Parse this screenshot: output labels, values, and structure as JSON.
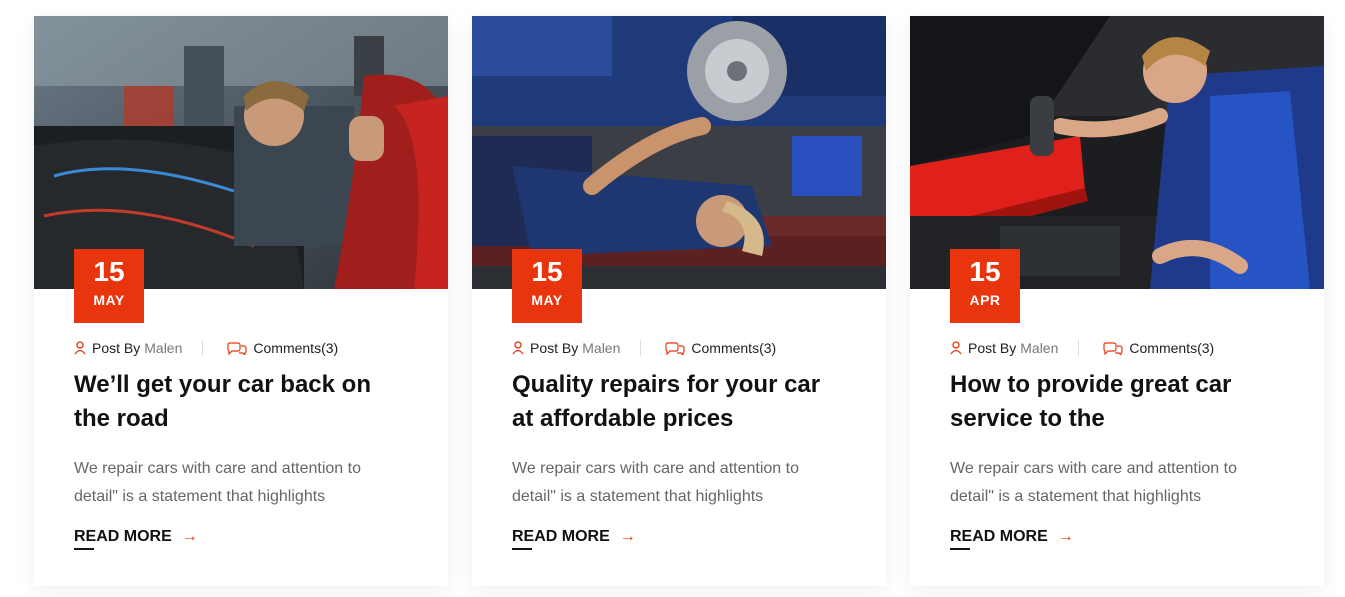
{
  "colors": {
    "accent": "#e8350d",
    "text": "#111111",
    "muted": "#666666"
  },
  "posts": [
    {
      "image": "mechanic inspecting car engine bay",
      "day": "15",
      "month": "MAY",
      "post_by_label": "Post By",
      "author": "Malen",
      "comments": "Comments(3)",
      "title": "We’ll get your car back on the road",
      "excerpt": "We repair cars with care and attention to detail\" is a statement that highlights",
      "read_more": "READ MORE"
    },
    {
      "image": "mechanic lying under car repairing brake disc",
      "day": "15",
      "month": "MAY",
      "post_by_label": "Post By",
      "author": "Malen",
      "comments": "Comments(3)",
      "title": "Quality repairs for your car at affordable prices",
      "excerpt": "We repair cars with care and attention to detail\" is a statement that highlights",
      "read_more": "READ MORE"
    },
    {
      "image": "mechanic using wrench on engine",
      "day": "15",
      "month": "APR",
      "post_by_label": "Post By",
      "author": "Malen",
      "comments": "Comments(3)",
      "title": "How to provide great car service to the",
      "excerpt": "We repair cars with care and attention to detail\" is a statement that highlights",
      "read_more": "READ MORE"
    }
  ]
}
